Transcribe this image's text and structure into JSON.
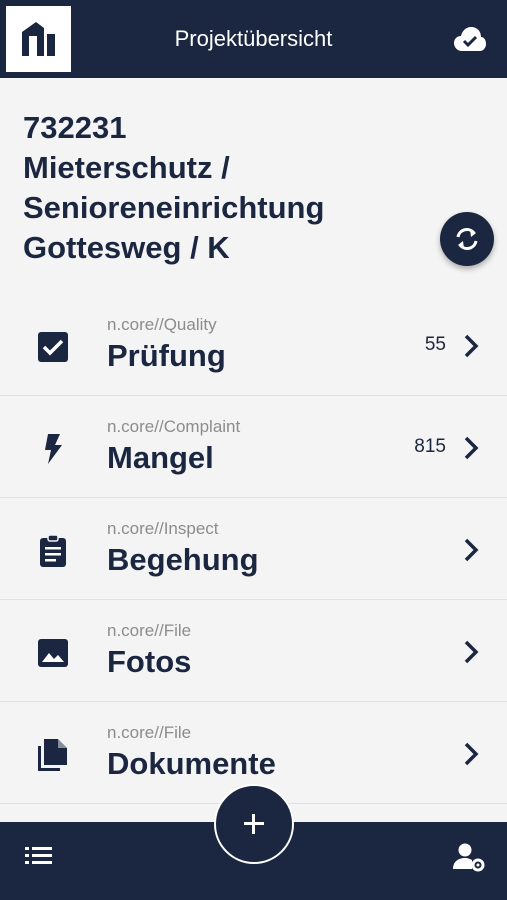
{
  "topbar": {
    "title": "Projektübersicht",
    "cloud_icon": "cloud-check-icon",
    "logo_icon": "n-logo-icon"
  },
  "project": {
    "title_lines": [
      "732231",
      "Mieterschutz /",
      "Senioreneinrichtung",
      "Gottesweg / K"
    ]
  },
  "modules": [
    {
      "sub": "n.core//Quality",
      "label": "Prüfung",
      "count": "55",
      "icon": "checkbox-icon"
    },
    {
      "sub": "n.core//Complaint",
      "label": "Mangel",
      "count": "815",
      "icon": "lightning-icon"
    },
    {
      "sub": "n.core//Inspect",
      "label": "Begehung",
      "count": "",
      "icon": "clipboard-icon"
    },
    {
      "sub": "n.core//File",
      "label": "Fotos",
      "count": "",
      "icon": "image-icon"
    },
    {
      "sub": "n.core//File",
      "label": "Dokumente",
      "count": "",
      "icon": "documents-icon"
    }
  ],
  "colors": {
    "navy": "#1b2640",
    "background": "#f4f4f4",
    "muted": "#8c8c8c"
  }
}
